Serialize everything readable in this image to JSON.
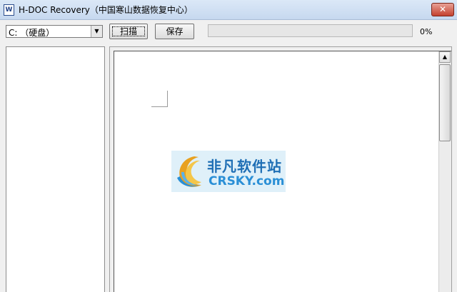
{
  "window": {
    "title": "H-DOC Recovery（中国寒山数据恢复中心）",
    "close_label": "✕",
    "app_icon_glyph": "W"
  },
  "toolbar": {
    "drive_value": "C: （硬盘）",
    "dropdown_glyph": "▼",
    "scan_label": "扫描",
    "save_label": "保存",
    "progress_fraction": 0,
    "progress_text": "0%"
  },
  "content": {
    "watermark_cn": "非凡软件站",
    "watermark_en": "CRSKY.com"
  },
  "scrollbar": {
    "up_glyph": "▲"
  },
  "colors": {
    "watermark_blue": "#1f6fb5",
    "watermark_bg": "#dff0f9",
    "titlebar": "#c6d8ef",
    "close_red": "#c4412f"
  },
  "icons": {
    "app": "document-w-icon",
    "close": "close-icon",
    "dropdown": "chevron-down-icon",
    "scroll_up": "arrow-up-icon",
    "watermark_logo": "crsky-logo-icon"
  }
}
